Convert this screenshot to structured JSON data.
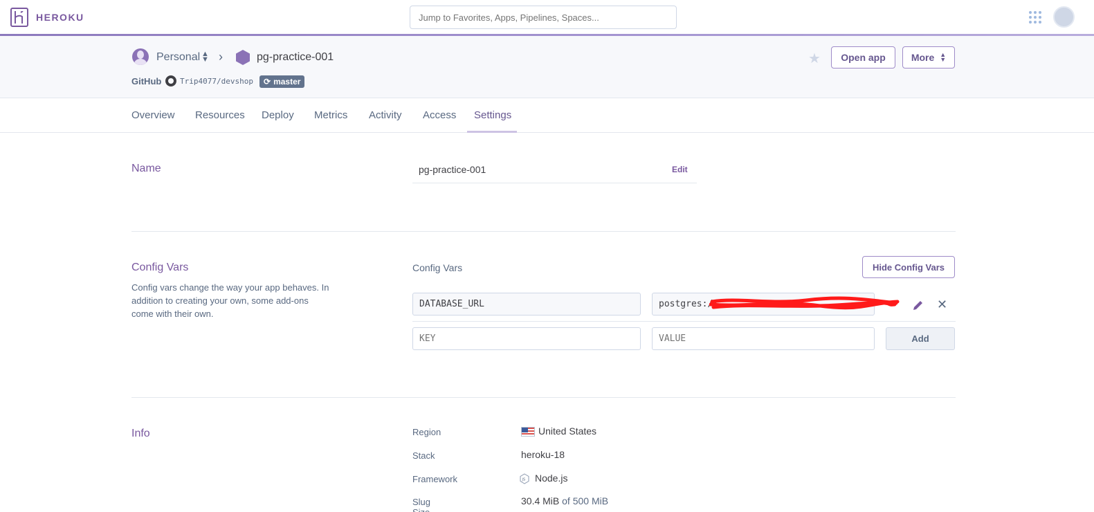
{
  "topbar": {
    "brand": "HEROKU",
    "search_placeholder": "Jump to Favorites, Apps, Pipelines, Spaces..."
  },
  "app_header": {
    "account": "Personal",
    "app_name": "pg-practice-001",
    "github_label": "GitHub",
    "repo": "Trip4077/devshop",
    "branch": "master",
    "open_app_label": "Open app",
    "more_label": "More"
  },
  "tabs": [
    "Overview",
    "Resources",
    "Deploy",
    "Metrics",
    "Activity",
    "Access",
    "Settings"
  ],
  "active_tab": "Settings",
  "name_section": {
    "title": "Name",
    "value": "pg-practice-001",
    "edit_label": "Edit"
  },
  "config_vars": {
    "title": "Config Vars",
    "description": "Config vars change the way your app behaves. In addition to creating your own, some add-ons come with their own.",
    "subtitle": "Config Vars",
    "hide_button": "Hide Config Vars",
    "vars": [
      {
        "key": "DATABASE_URL",
        "value": "postgres://"
      }
    ],
    "new_key_placeholder": "KEY",
    "new_value_placeholder": "VALUE",
    "add_button": "Add"
  },
  "info": {
    "title": "Info",
    "region_label": "Region",
    "region_value": "United States",
    "stack_label": "Stack",
    "stack_value": "heroku-18",
    "framework_label": "Framework",
    "framework_value": "Node.js",
    "slug_label": "Slug Size",
    "slug_used": "30.4 MiB",
    "slug_of": "of",
    "slug_total": "500 MiB"
  },
  "colors": {
    "brand_purple": "#79589f",
    "text": "#3f3f44",
    "muted": "#596981"
  }
}
